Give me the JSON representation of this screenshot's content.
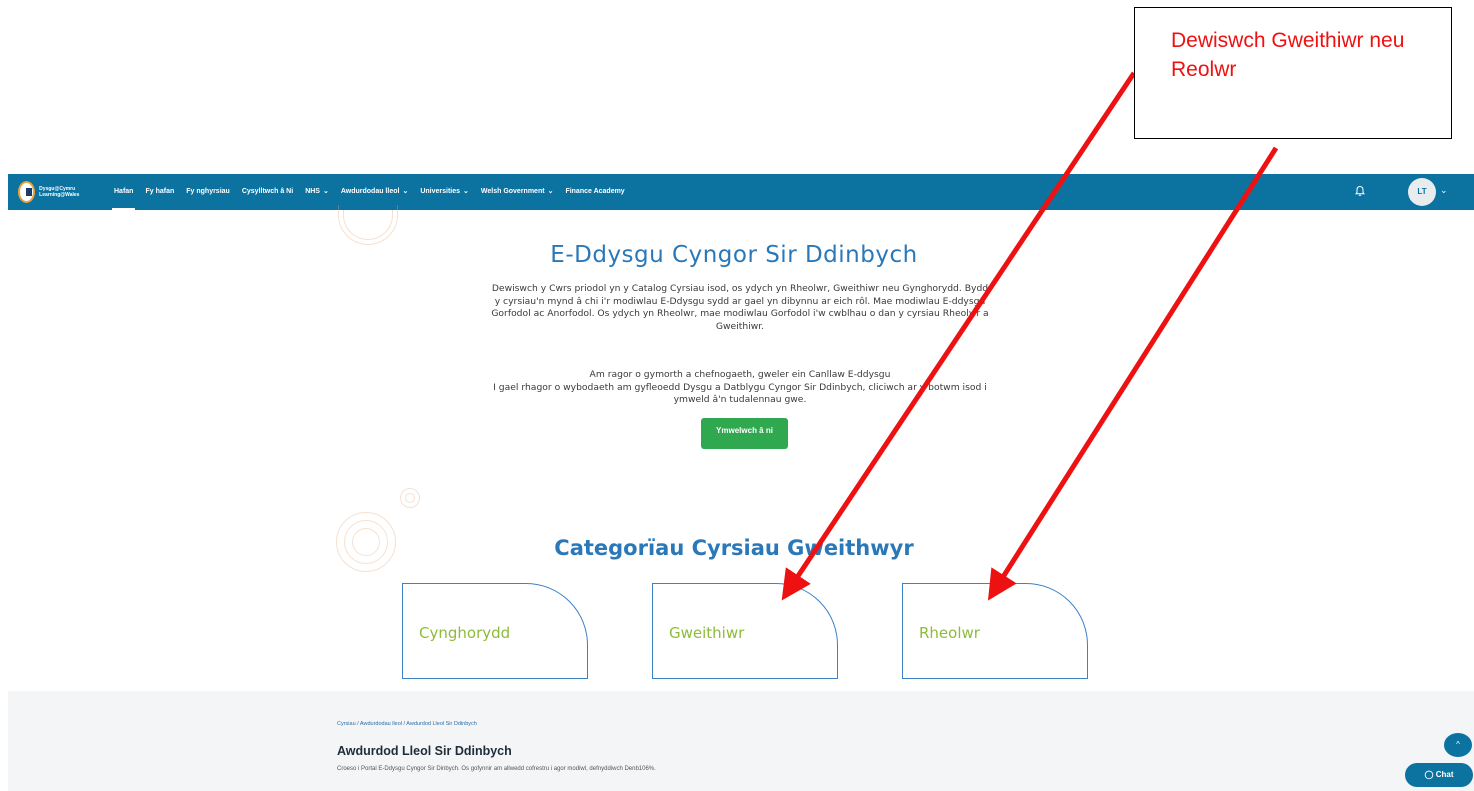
{
  "navbar": {
    "logo_text": "Dysgu@Cymru Learning@Wales",
    "items": [
      {
        "label": "Hafan",
        "dropdown": false,
        "active": true
      },
      {
        "label": "Fy hafan",
        "dropdown": false,
        "active": false
      },
      {
        "label": "Fy nghyrsiau",
        "dropdown": false,
        "active": false
      },
      {
        "label": "Cysylltwch â Ni",
        "dropdown": false,
        "active": false
      },
      {
        "label": "NHS",
        "dropdown": true,
        "active": false
      },
      {
        "label": "Awdurdodau lleol",
        "dropdown": true,
        "active": false
      },
      {
        "label": "Universities",
        "dropdown": true,
        "active": false
      },
      {
        "label": "Welsh Government",
        "dropdown": true,
        "active": false
      },
      {
        "label": "Finance Academy",
        "dropdown": false,
        "active": false
      }
    ],
    "avatar_initials": "LT",
    "icons": {
      "notifications": "bell-icon",
      "user_menu": "chevron-down-icon"
    }
  },
  "hero": {
    "title": "E-Ddysgu Cyngor Sir Ddinbych",
    "intro": "Dewiswch y Cwrs priodol yn y Catalog Cyrsiau isod, os ydych yn Rheolwr, Gweithiwr neu Gynghorydd. Bydd y cyrsiau'n mynd â chi i'r modiwlau E-Ddysgu sydd ar gael yn dibynnu ar eich rôl. Mae modiwlau E-ddysgu Gorfodol ac Anorfodol. Os ydych yn Rheolwr, mae modiwlau Gorfodol i'w cwblhau o dan y cyrsiau Rheolwr a Gweithiwr.",
    "help_line1": "Am ragor o gymorth a chefnogaeth, gweler ein Canllaw E-ddysgu",
    "help_line2": "I gael rhagor o wybodaeth am gyfleoedd Dysgu a Datblygu Cyngor Sir Ddinbych, cliciwch ar y botwm isod i ymweld â'n tudalennau gwe.",
    "button_label": "Ymwelwch â ni"
  },
  "categories": {
    "title": "Categorïau Cyrsiau Gweithwyr",
    "cards": [
      "Cynghorydd",
      "Gweithiwr",
      "Rheolwr"
    ]
  },
  "footer": {
    "breadcrumb": "Cyrsiau / Awdurdodau lleol / Awdurdod Lleol Sir Ddinbych",
    "title": "Awdurdod Lleol Sir Ddinbych",
    "description": "Croeso i Portal E-Ddysgu Cyngor Sir Dinbych. Os gofynnir am allwedd cofrestru i agor modiwl, defnyddiwch Denb106%.",
    "chat_label": "Chat",
    "scroll_top_icon": "chevron-up-icon"
  },
  "annotation": {
    "text": "Dewiswch Gweithiwr neu Reolwr",
    "text_color": "#ee1111",
    "arrow_color": "#ee1111"
  },
  "colors": {
    "navbar": "#0c72a0",
    "heading": "#2a78b8",
    "card_label": "#8dbb3a",
    "button": "#2fa84f"
  }
}
